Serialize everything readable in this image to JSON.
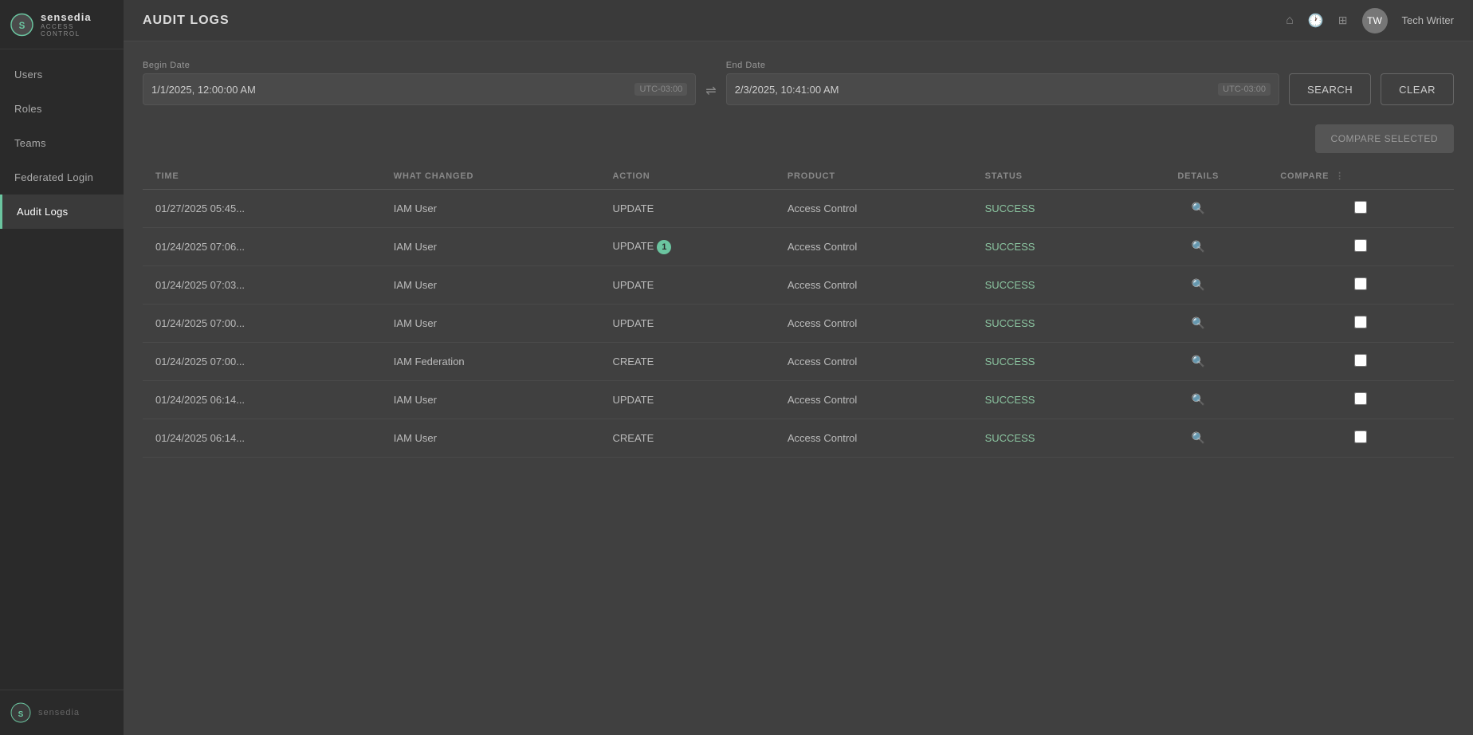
{
  "sidebar": {
    "logo_name": "sensedia",
    "logo_sub": "ACCESS CONTROL",
    "bottom_logo": "sensedia",
    "nav_items": [
      {
        "id": "users",
        "label": "Users",
        "active": false
      },
      {
        "id": "roles",
        "label": "Roles",
        "active": false
      },
      {
        "id": "teams",
        "label": "Teams",
        "active": false
      },
      {
        "id": "federated-login",
        "label": "Federated Login",
        "active": false
      },
      {
        "id": "audit-logs",
        "label": "Audit Logs",
        "active": true
      }
    ]
  },
  "topbar": {
    "title": "AUDIT LOGS",
    "user_name": "Tech Writer",
    "icons": {
      "home": "⌂",
      "clock": "🕐",
      "grid": "⊞"
    }
  },
  "filters": {
    "begin_date_label": "Begin Date",
    "begin_date_value": "1/1/2025, 12:00:00 AM",
    "begin_timezone": "UTC-03:00",
    "end_date_label": "End Date",
    "end_date_value": "2/3/2025, 10:41:00 AM",
    "end_timezone": "UTC-03:00",
    "search_label": "SEARCH",
    "clear_label": "CLEAR"
  },
  "compare_selected_label": "COMPARE SELECTED",
  "table": {
    "columns": [
      {
        "id": "time",
        "label": "TIME"
      },
      {
        "id": "what_changed",
        "label": "WHAT CHANGED"
      },
      {
        "id": "action",
        "label": "ACTION"
      },
      {
        "id": "product",
        "label": "PRODUCT"
      },
      {
        "id": "status",
        "label": "STATUS"
      },
      {
        "id": "details",
        "label": "DETAILS"
      },
      {
        "id": "compare",
        "label": "COMPARE"
      }
    ],
    "rows": [
      {
        "time": "01/27/2025 05:45...",
        "what_changed": "IAM User",
        "action": "UPDATE",
        "product": "Access Control",
        "status": "SUCCESS",
        "badge": null
      },
      {
        "time": "01/24/2025 07:06...",
        "what_changed": "IAM User",
        "action": "UPDATE",
        "product": "Access Control",
        "status": "SUCCESS",
        "badge": "1"
      },
      {
        "time": "01/24/2025 07:03...",
        "what_changed": "IAM User",
        "action": "UPDATE",
        "product": "Access Control",
        "status": "SUCCESS",
        "badge": null
      },
      {
        "time": "01/24/2025 07:00...",
        "what_changed": "IAM User",
        "action": "UPDATE",
        "product": "Access Control",
        "status": "SUCCESS",
        "badge": null
      },
      {
        "time": "01/24/2025 07:00...",
        "what_changed": "IAM Federation",
        "action": "CREATE",
        "product": "Access Control",
        "status": "SUCCESS",
        "badge": null
      },
      {
        "time": "01/24/2025 06:14...",
        "what_changed": "IAM User",
        "action": "UPDATE",
        "product": "Access Control",
        "status": "SUCCESS",
        "badge": null
      },
      {
        "time": "01/24/2025 06:14...",
        "what_changed": "IAM User",
        "action": "CREATE",
        "product": "Access Control",
        "status": "SUCCESS",
        "badge": null
      }
    ]
  }
}
